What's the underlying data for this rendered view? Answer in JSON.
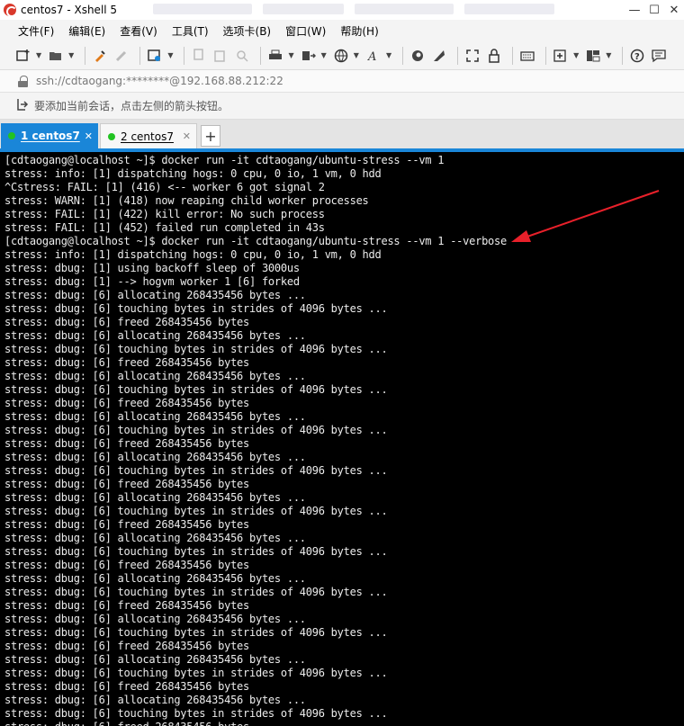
{
  "window": {
    "title": "centos7 - Xshell 5",
    "minimize_glyph": "—",
    "maximize_glyph": "☐",
    "close_glyph": "✕"
  },
  "menu": {
    "items": [
      "文件(F)",
      "编辑(E)",
      "查看(V)",
      "工具(T)",
      "选项卡(B)",
      "窗口(W)",
      "帮助(H)"
    ]
  },
  "toolbar": {
    "icons": [
      "new-session-icon",
      "open-folder-icon",
      "reconnect-icon",
      "disconnect-icon",
      "properties-icon",
      "copy-icon",
      "paste-icon",
      "find-icon",
      "print-icon",
      "transfer-icon",
      "globe-icon",
      "font-icon",
      "xftp-icon",
      "xmanager-icon",
      "fullscreen-icon",
      "lock-icon",
      "keyboard-icon",
      "new-tab-icon",
      "layout-icon",
      "help-icon",
      "chat-icon"
    ]
  },
  "address": {
    "text": "ssh://cdtaogang:********@192.168.88.212:22"
  },
  "hint": {
    "text": "要添加当前会话，点击左侧的箭头按钮。"
  },
  "tabs": [
    {
      "label": "1 centos7",
      "active": true
    },
    {
      "label": "2 centos7",
      "active": false
    }
  ],
  "add_tab_glyph": "+",
  "colors": {
    "accent": "#1a86d8",
    "status_dot": "#22c322",
    "terminal_bg": "#000000",
    "terminal_fg": "#ececec",
    "annotation_arrow": "#e8202a"
  },
  "terminal": {
    "lines": [
      "[cdtaogang@localhost ~]$ docker run -it cdtaogang/ubuntu-stress --vm 1",
      "stress: info: [1] dispatching hogs: 0 cpu, 0 io, 1 vm, 0 hdd",
      "^Cstress: FAIL: [1] (416) <-- worker 6 got signal 2",
      "stress: WARN: [1] (418) now reaping child worker processes",
      "stress: FAIL: [1] (422) kill error: No such process",
      "stress: FAIL: [1] (452) failed run completed in 43s",
      "[cdtaogang@localhost ~]$ docker run -it cdtaogang/ubuntu-stress --vm 1 --verbose",
      "stress: info: [1] dispatching hogs: 0 cpu, 0 io, 1 vm, 0 hdd",
      "stress: dbug: [1] using backoff sleep of 3000us",
      "stress: dbug: [1] --> hogvm worker 1 [6] forked",
      "stress: dbug: [6] allocating 268435456 bytes ...",
      "stress: dbug: [6] touching bytes in strides of 4096 bytes ...",
      "stress: dbug: [6] freed 268435456 bytes",
      "stress: dbug: [6] allocating 268435456 bytes ...",
      "stress: dbug: [6] touching bytes in strides of 4096 bytes ...",
      "stress: dbug: [6] freed 268435456 bytes",
      "stress: dbug: [6] allocating 268435456 bytes ...",
      "stress: dbug: [6] touching bytes in strides of 4096 bytes ...",
      "stress: dbug: [6] freed 268435456 bytes",
      "stress: dbug: [6] allocating 268435456 bytes ...",
      "stress: dbug: [6] touching bytes in strides of 4096 bytes ...",
      "stress: dbug: [6] freed 268435456 bytes",
      "stress: dbug: [6] allocating 268435456 bytes ...",
      "stress: dbug: [6] touching bytes in strides of 4096 bytes ...",
      "stress: dbug: [6] freed 268435456 bytes",
      "stress: dbug: [6] allocating 268435456 bytes ...",
      "stress: dbug: [6] touching bytes in strides of 4096 bytes ...",
      "stress: dbug: [6] freed 268435456 bytes",
      "stress: dbug: [6] allocating 268435456 bytes ...",
      "stress: dbug: [6] touching bytes in strides of 4096 bytes ...",
      "stress: dbug: [6] freed 268435456 bytes",
      "stress: dbug: [6] allocating 268435456 bytes ...",
      "stress: dbug: [6] touching bytes in strides of 4096 bytes ...",
      "stress: dbug: [6] freed 268435456 bytes",
      "stress: dbug: [6] allocating 268435456 bytes ...",
      "stress: dbug: [6] touching bytes in strides of 4096 bytes ...",
      "stress: dbug: [6] freed 268435456 bytes",
      "stress: dbug: [6] allocating 268435456 bytes ...",
      "stress: dbug: [6] touching bytes in strides of 4096 bytes ...",
      "stress: dbug: [6] freed 268435456 bytes",
      "stress: dbug: [6] allocating 268435456 bytes ...",
      "stress: dbug: [6] touching bytes in strides of 4096 bytes ...",
      "stress: dbug: [6] freed 268435456 bytes",
      "stress: dbug: [6] allocating 268435456 bytes ...",
      "stress: dbug: [6] touching bytes in strides of 4096 bytes ..."
    ]
  }
}
